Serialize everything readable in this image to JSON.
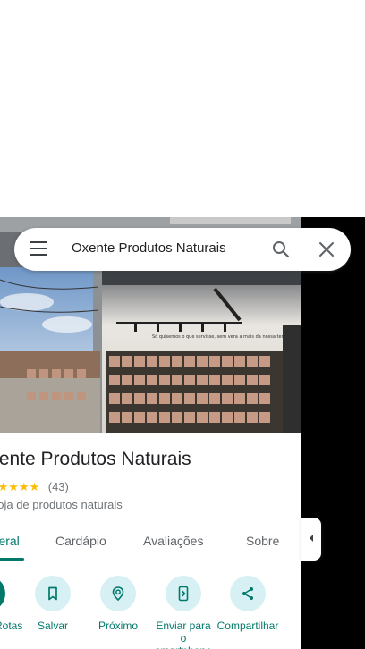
{
  "search": {
    "query": "Oxente Produtos Naturais"
  },
  "place": {
    "name": "Oxente Produtos Naturais",
    "stars": "★★★★★",
    "rating_count": "(43)",
    "category": "Loja de produtos naturais"
  },
  "photo": {
    "wall_text": "Só quisemos o que servisse, sem vera a mais da nossa terra."
  },
  "tabs": [
    {
      "label": "Visão geral",
      "active": true
    },
    {
      "label": "Cardápio"
    },
    {
      "label": "Avaliações"
    },
    {
      "label": "Sobre"
    }
  ],
  "actions": [
    {
      "label": "Rotas",
      "icon": "directions-icon"
    },
    {
      "label": "Salvar",
      "icon": "bookmark-icon"
    },
    {
      "label": "Próximo",
      "icon": "nearby-icon"
    },
    {
      "label": "Enviar para o smartphone",
      "icon": "send-to-phone-icon"
    },
    {
      "label": "Compartilhar",
      "icon": "share-icon"
    }
  ],
  "colors": {
    "accent": "#00796b",
    "action_bg": "#d7f0f4",
    "star": "#fbbc04"
  }
}
